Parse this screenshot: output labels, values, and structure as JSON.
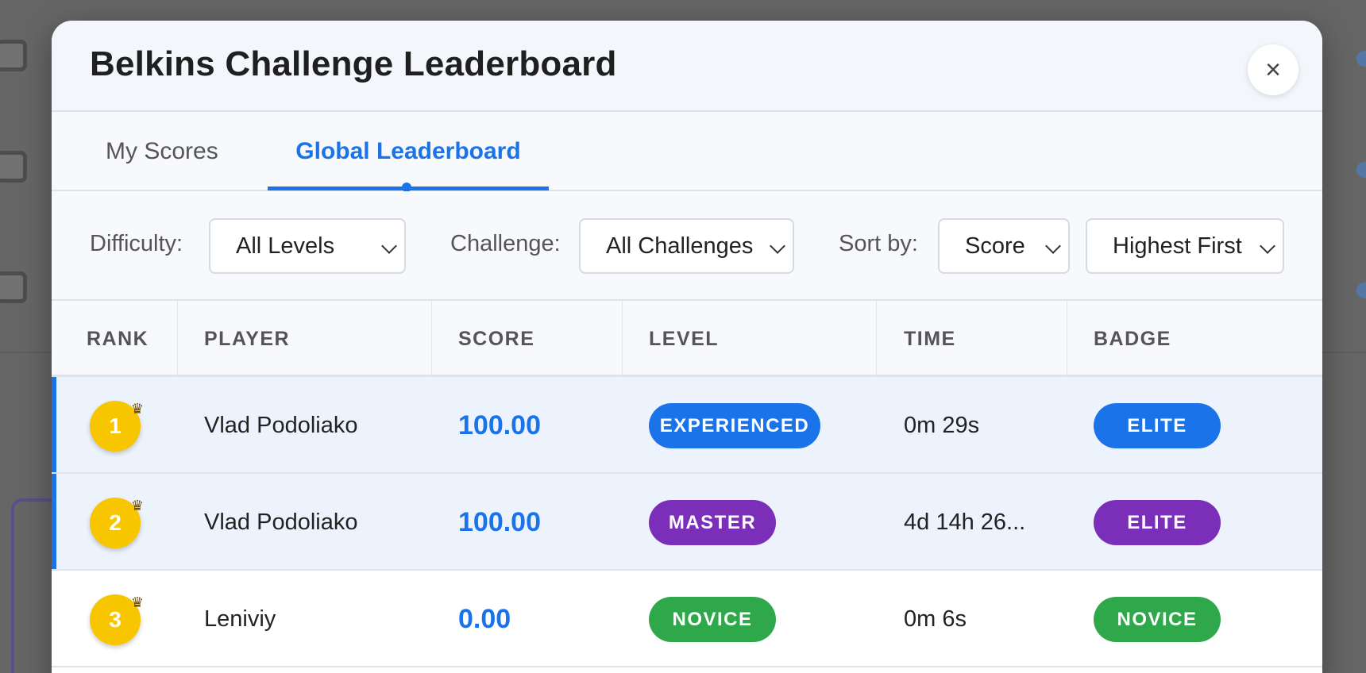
{
  "modal": {
    "title": "Belkins Challenge Leaderboard",
    "close_symbol": "×"
  },
  "tabs": [
    {
      "label": "My Scores",
      "active": false
    },
    {
      "label": "Global Leaderboard",
      "active": true
    }
  ],
  "filters": {
    "difficulty_label": "Difficulty:",
    "difficulty_value": "All Levels",
    "challenge_label": "Challenge:",
    "challenge_value": "All Challenges",
    "sort_label": "Sort by:",
    "sort_value": "Score",
    "order_value": "Highest First"
  },
  "table": {
    "headers": [
      "RANK",
      "PLAYER",
      "SCORE",
      "LEVEL",
      "TIME",
      "BADGE"
    ],
    "rows": [
      {
        "rank": "1",
        "player": "Vlad Podoliako",
        "score": "100.00",
        "level": "EXPERIENCED",
        "time": "0m 29s",
        "badge": "ELITE",
        "level_color": "#1a73e8",
        "badge_color": "#1a73e8"
      },
      {
        "rank": "2",
        "player": "Vlad Podoliako",
        "score": "100.00",
        "level": "MASTER",
        "time": "4d 14h 26...",
        "badge": "ELITE",
        "level_color": "#7b2fb8",
        "badge_color": "#7b2fb8"
      },
      {
        "rank": "3",
        "player": "Leniviy",
        "score": "0.00",
        "level": "NOVICE",
        "time": "0m 6s",
        "badge": "NOVICE",
        "level_color": "#2ea84a",
        "badge_color": "#2ea84a"
      }
    ]
  },
  "colors": {
    "accent": "#1a73e8",
    "rank_gold": "#f7c600"
  },
  "icons": {
    "close": "close-icon",
    "rank_crown": "crown-icon",
    "dropdown": "chevron-down-icon"
  }
}
